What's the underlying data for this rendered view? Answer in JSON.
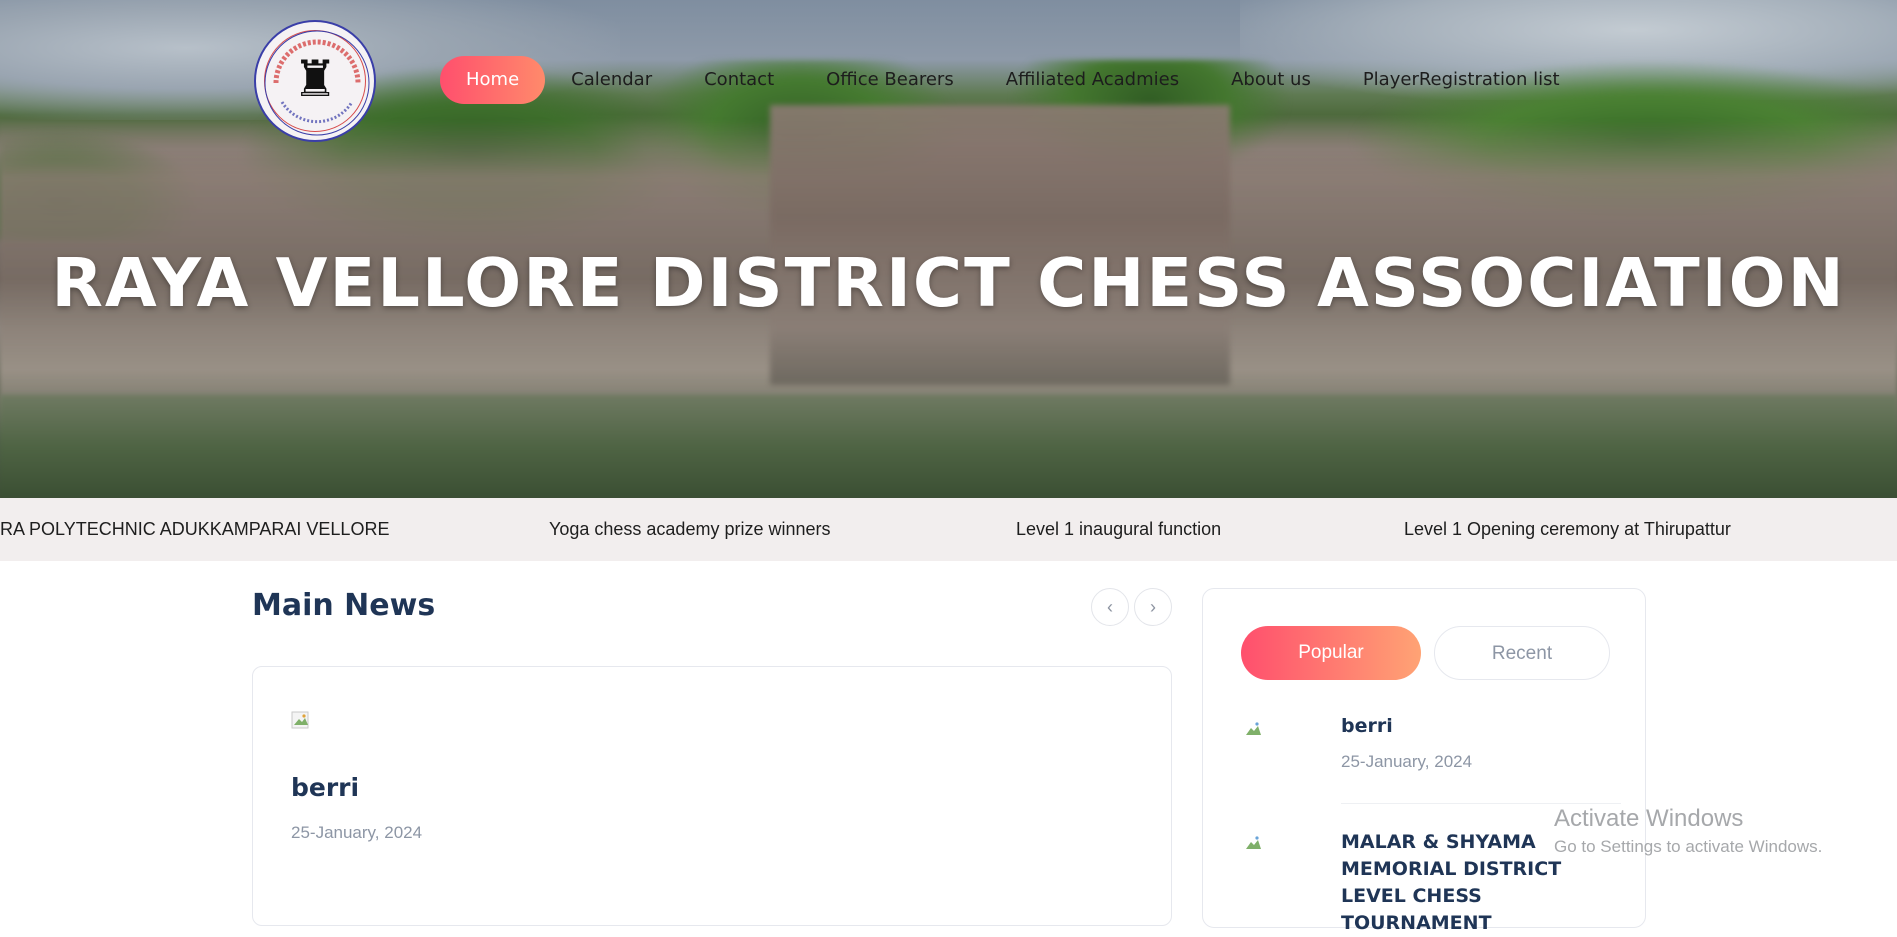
{
  "site": {
    "logo_alt": "Raya Vellore District Chess Association logo",
    "hero_title": "RAYA VELLORE DISTRICT CHESS ASSOCIATION"
  },
  "nav": {
    "items": [
      {
        "label": "Home",
        "active": true
      },
      {
        "label": "Calendar"
      },
      {
        "label": "Contact"
      },
      {
        "label": "Office Bearers"
      },
      {
        "label": "Affiliated Acadmies"
      },
      {
        "label": "About us"
      },
      {
        "label": "PlayerRegistration list"
      }
    ]
  },
  "ticker": {
    "items": [
      "RA POLYTECHNIC ADUKKAMPARAI VELLORE",
      "Yoga chess academy prize winners",
      "Level 1 inaugural function",
      "Level 1 Opening ceremony at Thirupattur"
    ]
  },
  "main_news": {
    "heading": "Main News",
    "prev_icon": "chevron-left-icon",
    "next_icon": "chevron-right-icon",
    "article": {
      "title": "berri",
      "date": "25-January, 2024"
    }
  },
  "sidebar": {
    "tabs": [
      {
        "label": "Popular",
        "active": true
      },
      {
        "label": "Recent"
      }
    ],
    "items": [
      {
        "title": "berri",
        "date": "25-January, 2024"
      },
      {
        "title": "MALAR & SHYAMA MEMORIAL DISTRICT LEVEL CHESS TOURNAMENT"
      }
    ]
  },
  "overlay": {
    "line1": "Activate Windows",
    "line2": "Go to Settings to activate Windows."
  },
  "colors": {
    "accent_start": "#ff4f6d",
    "accent_end": "#ff8a6b",
    "heading": "#1f3556",
    "muted": "#8d96a5"
  }
}
